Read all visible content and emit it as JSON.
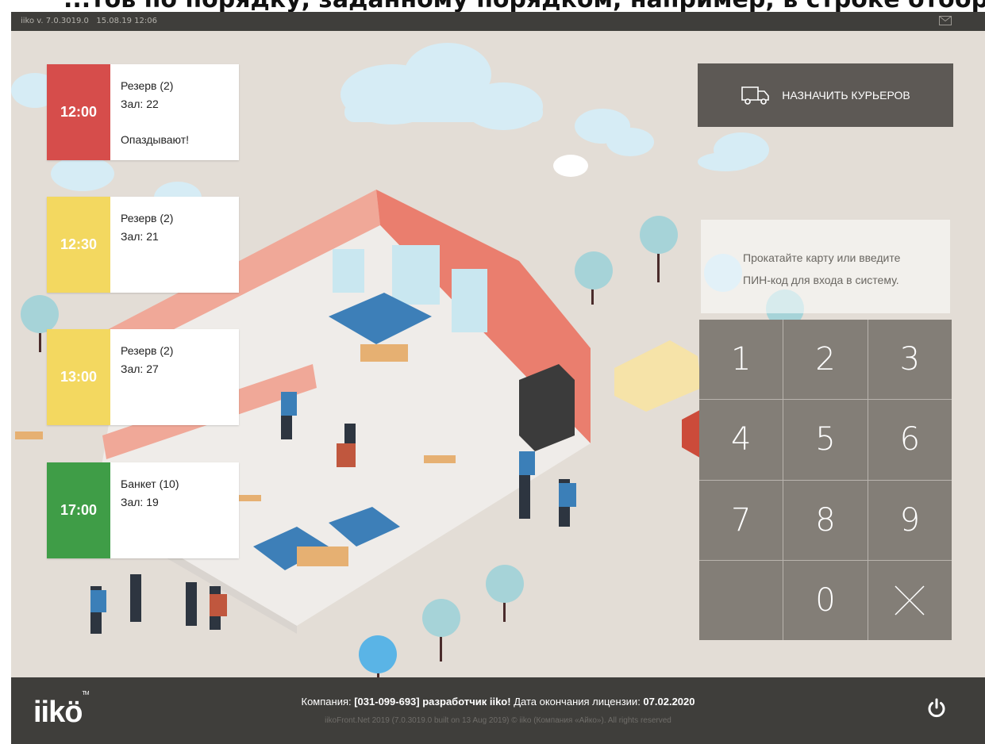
{
  "top_banner_text": "...тов по порядку, заданному порядком, например, в строке отображ...",
  "titlebar": {
    "version": "iiko v. 7.0.3019.0",
    "datetime": "15.08.19  12:06"
  },
  "reservations": [
    {
      "time": "12:00",
      "title": "Резерв (2)",
      "hall": "Зал: 22",
      "note": "Опаздывают!",
      "color": "#d64d4b"
    },
    {
      "time": "12:30",
      "title": "Резерв (2)",
      "hall": "Зал: 21",
      "note": "",
      "color": "#f3d860"
    },
    {
      "time": "13:00",
      "title": "Резерв (2)",
      "hall": "Зал: 27",
      "note": "",
      "color": "#f3d860"
    },
    {
      "time": "17:00",
      "title": "Банкет (10)",
      "hall": "Зал: 19",
      "note": "",
      "color": "#3f9d47"
    }
  ],
  "courier_button": {
    "label": "НАЗНАЧИТЬ КУРЬЕРОВ",
    "icon": "truck-icon"
  },
  "pin_prompt": {
    "line1": "Прокатайте карту или введите",
    "line2": "ПИН-код для входа в систему."
  },
  "keypad": {
    "keys": [
      "1",
      "2",
      "3",
      "4",
      "5",
      "6",
      "7",
      "8",
      "9",
      "",
      "0",
      "×"
    ]
  },
  "footer": {
    "logo": "iikö",
    "tm": "TM",
    "company_prefix": "Компания: ",
    "company_bold": "[031-099-693] разработчик iiko!",
    "license_label": " Дата окончания лицензии: ",
    "license_date": "07.02.2020",
    "build": "iikoFront.Net 2019 (7.0.3019.0 built on 13 Aug 2019) © iiko (Компания «Айко»). All rights reserved"
  },
  "colors": {
    "titlebar": "#3f3e3b",
    "background": "#e3ddd6",
    "status_led": "#0a8a2a"
  }
}
